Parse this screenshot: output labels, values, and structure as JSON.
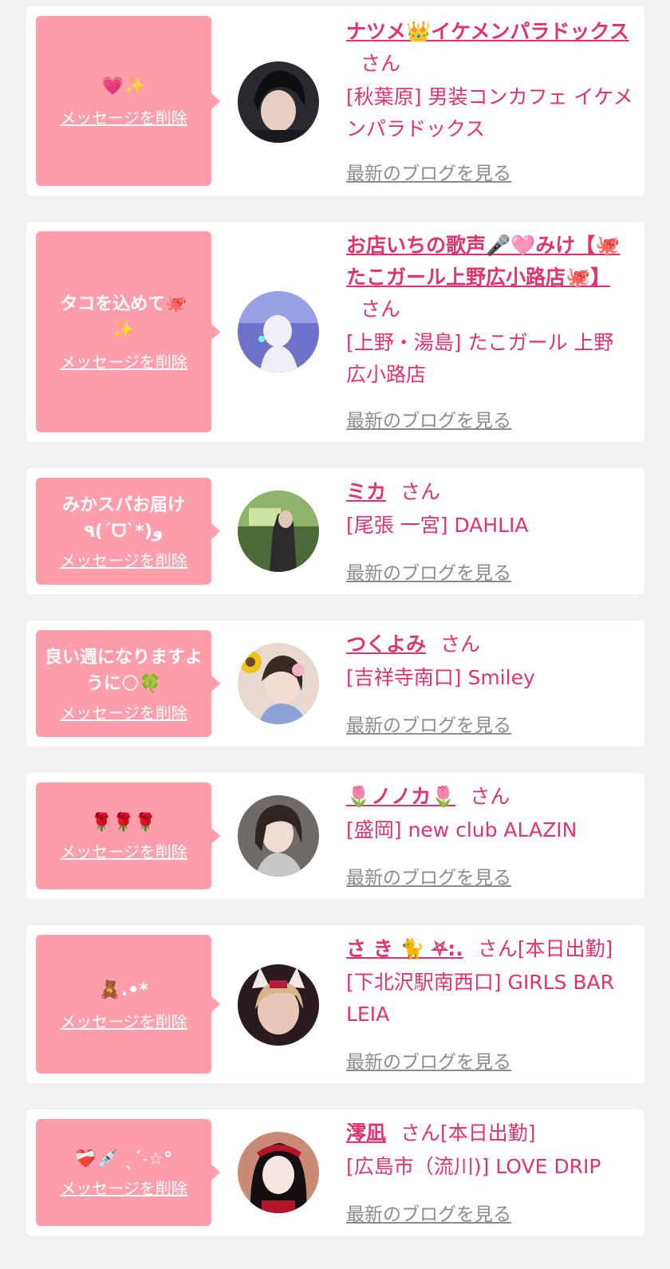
{
  "delete_label": "メッセージを削除",
  "blog_label": "最新のブログを見る",
  "colors": {
    "page_bg": "#f2f2f3",
    "bubble": "#fe9eab",
    "accent": "#e3336b",
    "link_gray": "#8c8c8c"
  },
  "items": [
    {
      "message": "💗✨",
      "name": "ナツメ👑イケメンパラドックス",
      "suffix": "さん",
      "shop": "[秋葉原] 男装コンカフェ イケメンパラドックス"
    },
    {
      "message": "タコを込めて🐙✨",
      "name": "お店いちの歌声🎤🩷みけ【🐙たこガール上野広小路店🐙】",
      "suffix": "さん",
      "shop": "[上野・湯島] たこガール 上野広小路店"
    },
    {
      "message": "みかスパお届け\n٩(ˊᗜˋ*)و",
      "name": "ミカ",
      "suffix": "さん",
      "shop": "[尾張 一宮] DAHLIA"
    },
    {
      "message": "良い週になりますように🌕🍀",
      "name": "つくよみ",
      "suffix": "さん",
      "shop": "[吉祥寺南口] Smiley"
    },
    {
      "message": "🌹🌹🌹",
      "name": "🌷ノノカ🌷",
      "suffix": "さん",
      "shop": "[盛岡] new club ALAZIN"
    },
    {
      "message": "🧸.•*",
      "name": "さ き 🐈 ⛧:.",
      "suffix": "さん[本日出勤]",
      "shop": "[下北沢駅南西口] GIRLS BAR LEIA"
    },
    {
      "message": "❤️‍🩹💉 ˎˊ˗☆°",
      "name": "澪凪",
      "suffix": "さん[本日出勤]",
      "shop": "[広島市（流川)] LOVE DRIP"
    }
  ]
}
